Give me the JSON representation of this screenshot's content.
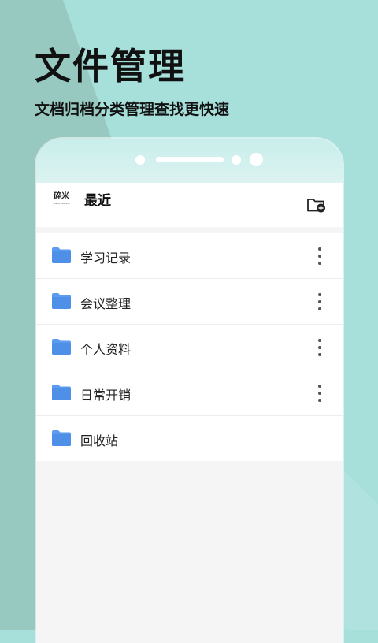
{
  "promo": {
    "title": "文件管理",
    "subtitle": "文档归档分类管理查找更快速"
  },
  "app": {
    "logo_text": "碎米",
    "logo_subtext": "SUIMI·FILE·PIC",
    "title": "最近",
    "new_folder_icon": "folder-plus-icon"
  },
  "folders": [
    {
      "name": "学习记录",
      "icon": "folder-icon",
      "has_menu": true
    },
    {
      "name": "会议整理",
      "icon": "folder-icon",
      "has_menu": true
    },
    {
      "name": "个人资料",
      "icon": "folder-icon",
      "has_menu": true
    },
    {
      "name": "日常开销",
      "icon": "folder-icon",
      "has_menu": true
    },
    {
      "name": "回收站",
      "icon": "folder-icon",
      "has_menu": false
    }
  ],
  "colors": {
    "background": "#a7dfdb",
    "background_shade": "#97c9c0",
    "folder": "#5b9cf0",
    "text": "#111111"
  }
}
